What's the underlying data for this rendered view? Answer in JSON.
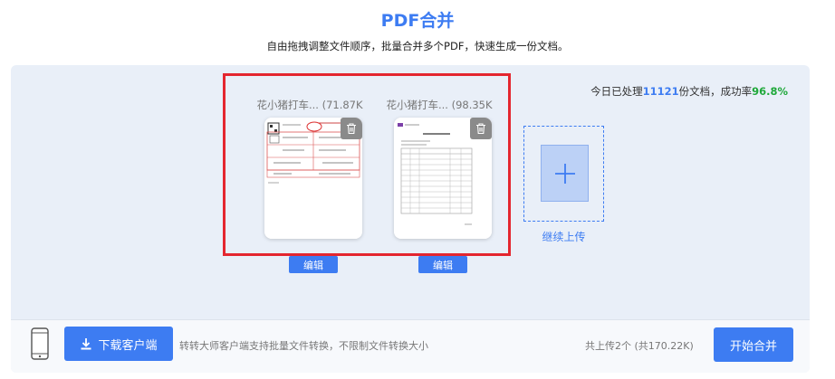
{
  "header": {
    "title": "PDF合并",
    "subtitle": "自由拖拽调整文件顺序，批量合并多个PDF，快速生成一份文档。"
  },
  "stats": {
    "prefix": "今日已处理",
    "count": "11121",
    "middle": "份文档，成功率",
    "rate": "96.8%"
  },
  "files": [
    {
      "name": "花小猪打车...",
      "size": "(71.87K",
      "edit_label": "编辑"
    },
    {
      "name": "花小猪打车...",
      "size": "(98.35K",
      "edit_label": "编辑"
    }
  ],
  "upload": {
    "label": "继续上传"
  },
  "footer": {
    "download_label": "下载客户端",
    "client_text": "转转大师客户端支持批量文件转换，不限制文件转换大小",
    "total_text": "共上传2个 (共170.22K)",
    "merge_label": "开始合并"
  },
  "colors": {
    "accent": "#3d7cf2",
    "success": "#1fa83a",
    "highlight": "#e4262f"
  },
  "icons": [
    "trash-icon",
    "plus-icon",
    "download-icon",
    "phone-icon"
  ]
}
